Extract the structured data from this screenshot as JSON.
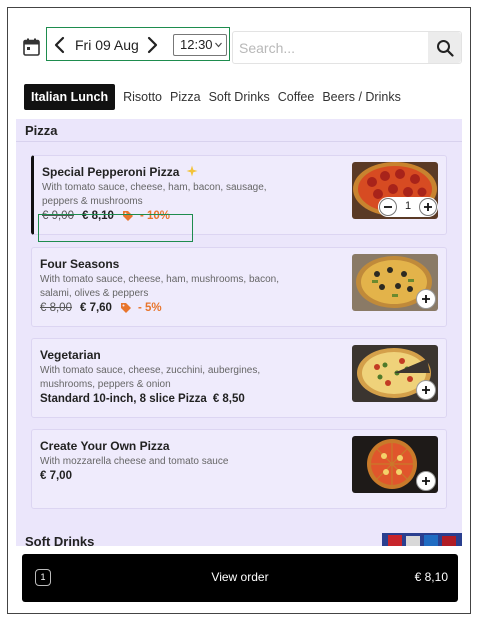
{
  "header": {
    "date": "Fri 09 Aug",
    "time": "12:30",
    "search_placeholder": "Search..."
  },
  "tabs": [
    {
      "label": "Italian Lunch",
      "active": true
    },
    {
      "label": "Risotto"
    },
    {
      "label": "Pizza"
    },
    {
      "label": "Soft Drinks"
    },
    {
      "label": "Coffee"
    },
    {
      "label": "Beers / Drinks"
    }
  ],
  "sections": {
    "pizza": "Pizza",
    "soft_drinks": "Soft Drinks"
  },
  "items": [
    {
      "name": "Special Pepperoni Pizza",
      "badge_icon": "sparkle-icon",
      "description": "With tomato sauce, cheese, ham, bacon, sausage, peppers & mushrooms",
      "old_price": "€ 9,00",
      "price": "€ 8,10",
      "discount": "- 10%",
      "quantity": "1",
      "image": "pepperoni-pizza"
    },
    {
      "name": "Four Seasons",
      "description": "With tomato sauce, cheese, ham, mushrooms, bacon, salami, olives & peppers",
      "old_price": "€ 8,00",
      "price": "€ 7,60",
      "discount": "- 5%",
      "image": "four-seasons-pizza"
    },
    {
      "name": "Vegetarian",
      "description": "With tomato sauce, cheese, zucchini, aubergines, mushrooms, peppers & onion",
      "info": "Standard 10-inch, 8 slice Pizza",
      "price": "€ 8,50",
      "image": "vegetarian-pizza"
    },
    {
      "name": "Create Your Own Pizza",
      "description": "With mozzarella cheese and tomato sauce",
      "price": "€ 7,00",
      "image": "custom-pizza"
    }
  ],
  "order": {
    "count": "1",
    "label": "View order",
    "total": "€ 8,10"
  },
  "colors": {
    "background": "#ebe6fb",
    "card": "#efebfc",
    "accent": "#1e8c4e",
    "discount": "#e8752c",
    "order_bar": "#000000"
  }
}
